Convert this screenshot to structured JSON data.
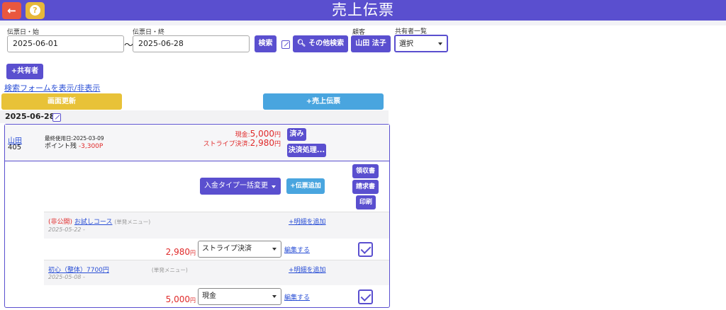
{
  "header": {
    "title": "売上伝票",
    "back_icon": "arrow-left-icon",
    "help_icon": "question-icon",
    "help_text": "?",
    "back_text": "←",
    "accent": "#5a4fcf"
  },
  "search": {
    "start_label": "伝票日・始",
    "start_value": "2025-06-01",
    "tilde": "〜",
    "end_label": "伝票日・終",
    "end_value": "2025-06-28",
    "search_btn": "検索",
    "other_search_btn": "その他検索",
    "customer_label": "顧客",
    "customer_value": "山田 法子",
    "sharer_list_label": "共有者一覧",
    "sharer_select": "選択",
    "add_sharer_btn": "+共有者",
    "toggle_link": "検索フォームを表示/非表示"
  },
  "actions": {
    "refresh_btn": "画面更新",
    "new_slip_btn": "+売上伝票"
  },
  "slip": {
    "date": "2025-06-28",
    "customer_name": "山田",
    "customer_id": "405",
    "last_used": "最終使用日:2025-03-09",
    "points_label": "ポイント残",
    "points_value": "-3,300P",
    "cash_label": "現金:",
    "cash_value": "5,000",
    "cash_unit": "円",
    "stripe_label": "ストライプ決済:",
    "stripe_value": "2,980",
    "stripe_unit": "円",
    "done_btn": "済み",
    "settle_btn": "決済処理...",
    "bulk_change_btn": "入金タイプ一括変更",
    "add_slip_btn": "+伝票追加",
    "receipt_btn": "領収書",
    "invoice_btn": "請求書",
    "print_btn": "印刷",
    "items": [
      {
        "visibility": "(非公開)",
        "name": "お試しコース",
        "menu_type": "(単発メニュー)",
        "date": "2025-05-22 -",
        "add_detail": "+明細を追加",
        "amount": "2,980",
        "unit": "円",
        "pay_type": "ストライプ決済",
        "edit": "編集する"
      },
      {
        "visibility": "",
        "name": "初心（整体）7700円",
        "menu_type": "(単発メニュー)",
        "date": "2025-05-08 -",
        "add_detail": "+明細を追加",
        "amount": "5,000",
        "unit": "円",
        "pay_type": "現金",
        "edit": "編集する"
      }
    ]
  }
}
